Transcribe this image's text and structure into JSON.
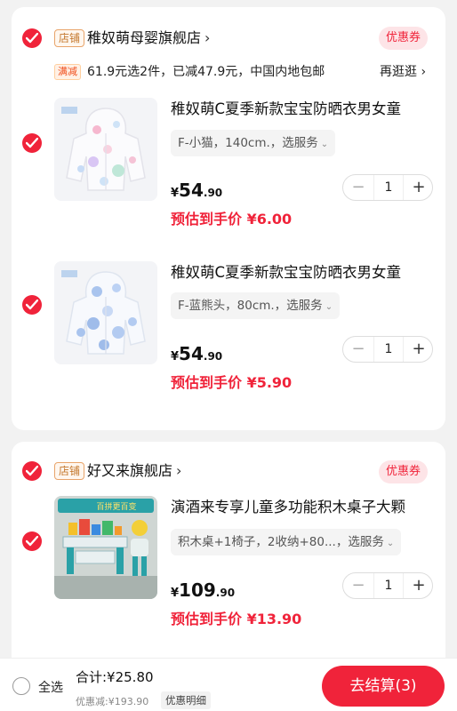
{
  "colors": {
    "accent": "#f0233a",
    "card_bg": "#ffffff",
    "page_bg": "#f2f2f2"
  },
  "stores": [
    {
      "tag": "店铺",
      "name": "稚奴萌母婴旗舰店",
      "chevron": "›",
      "coupon": "优惠券",
      "promo": {
        "tag": "满减",
        "text": "61.9元选2件，已减47.9元，中国内地包邮",
        "more": "再逛逛 ›"
      },
      "items": [
        {
          "title": "稚奴萌C夏季新款宝宝防晒衣男女童",
          "sku": "F-小猫，140cm.，选服务",
          "price_cur": "¥",
          "price_int": "54",
          "price_dec": ".90",
          "qty": "1",
          "est": "预估到手价 ¥6.00"
        },
        {
          "title": "稚奴萌C夏季新款宝宝防晒衣男女童",
          "sku": "F-蓝熊头，80cm.，选服务",
          "price_cur": "¥",
          "price_int": "54",
          "price_dec": ".90",
          "qty": "1",
          "est": "预估到手价 ¥5.90"
        }
      ]
    },
    {
      "tag": "店铺",
      "name": "好又来旗舰店",
      "chevron": "›",
      "coupon": "优惠券",
      "items": [
        {
          "title": "演酒来专享儿童多功能积木桌子大颗",
          "sku": "积木桌+1椅子，2收纳+80...，选服务",
          "price_cur": "¥",
          "price_int": "109",
          "price_dec": ".90",
          "qty": "1",
          "est": "预估到手价 ¥13.90",
          "thumb_text": "百拼更百变"
        }
      ]
    }
  ],
  "bottom": {
    "select_all": "全选",
    "total": "合计:¥25.80",
    "discount": "优惠减:¥193.90",
    "detail": "优惠明细",
    "checkout": "去结算(3)"
  },
  "symbols": {
    "minus": "−",
    "plus": "+",
    "caret": "⌄"
  }
}
